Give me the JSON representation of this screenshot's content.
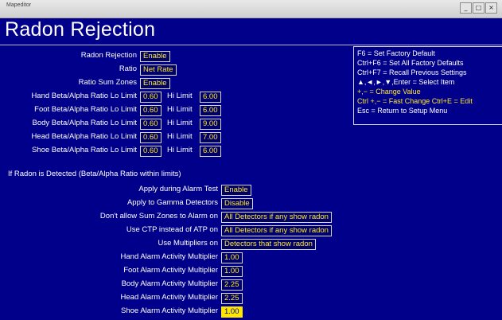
{
  "window": {
    "caption": "Mapeditor",
    "min": "_",
    "max": "□",
    "close": "×"
  },
  "page": {
    "title": "Radon Rejection"
  },
  "top_settings": [
    {
      "label": "Radon Rejection",
      "value": "Enable"
    },
    {
      "label": "Ratio",
      "value": "Net Rate"
    },
    {
      "label": "Ratio Sum Zones",
      "value": "Enable"
    }
  ],
  "hi_limit_label": "Hi Limit",
  "limits": [
    {
      "label": "Hand Beta/Alpha Ratio Lo Limit",
      "lo": "0.60",
      "hi": "6.00"
    },
    {
      "label": "Foot Beta/Alpha Ratio Lo Limit",
      "lo": "0.60",
      "hi": "6.00"
    },
    {
      "label": "Body Beta/Alpha Ratio Lo Limit",
      "lo": "0.60",
      "hi": "9.00"
    },
    {
      "label": "Head Beta/Alpha Ratio Lo Limit",
      "lo": "0.60",
      "hi": "7.00"
    },
    {
      "label": "Shoe Beta/Alpha Ratio Lo Limit",
      "lo": "0.60",
      "hi": "6.00"
    }
  ],
  "section_title": "If Radon is Detected (Beta/Alpha Ratio within limits)",
  "detected_settings": [
    {
      "label": "Apply during Alarm Test",
      "value": "Enable"
    },
    {
      "label": "Apply to Gamma Detectors",
      "value": "Disable"
    },
    {
      "label": "Don't allow Sum Zones to Alarm on",
      "value": "All Detectors if any show radon"
    },
    {
      "label": "Use CTP instead of ATP on",
      "value": "All Detectors if any show radon"
    },
    {
      "label": "Use Multipliers on",
      "value": "Detectors that show radon"
    },
    {
      "label": "Hand Alarm Activity Multiplier",
      "value": "1.00"
    },
    {
      "label": "Foot Alarm Activity Multiplier",
      "value": "1.00"
    },
    {
      "label": "Body Alarm Activity Multiplier",
      "value": "2.25"
    },
    {
      "label": "Head Alarm Activity Multiplier",
      "value": "2.25"
    },
    {
      "label": "Shoe Alarm Activity Multiplier",
      "value": "1.00"
    }
  ],
  "help": [
    {
      "text": "F6 = Set Factory Default",
      "color": "#ffffff"
    },
    {
      "text": "Ctrl+F6 = Set All Factory Defaults",
      "color": "#ffffff"
    },
    {
      "text": "Ctrl+F7 = Recall Previous Settings",
      "color": "#ffffff"
    },
    {
      "text": "▲,◄,►,▼,Enter = Select Item",
      "color": "#ffffff"
    },
    {
      "text": "+,− = Change Value",
      "color": "#ffe830"
    },
    {
      "text": "Ctrl +,− = Fast Change   Ctrl+E = Edit",
      "color": "#ffe830"
    },
    {
      "text": "Esc = Return to Setup Menu",
      "color": "#ffffff"
    }
  ]
}
